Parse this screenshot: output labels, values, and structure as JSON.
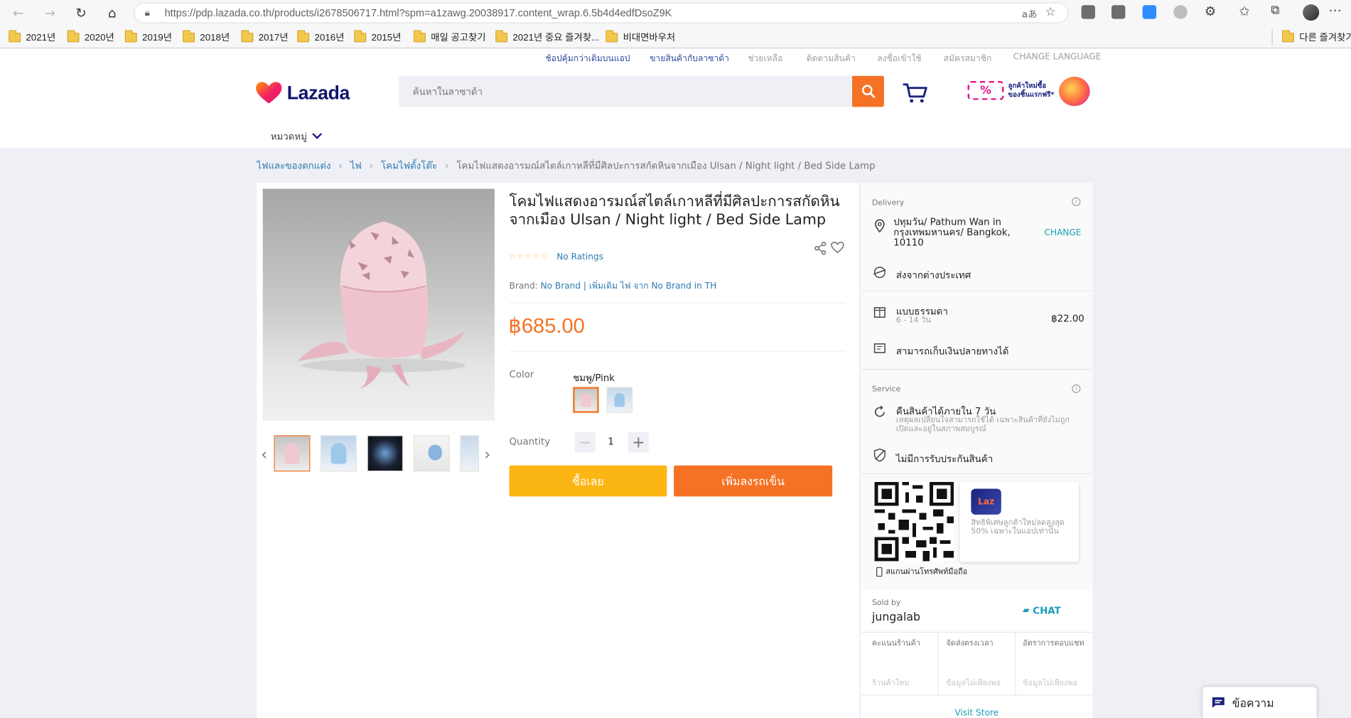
{
  "browser": {
    "url": "https://pdp.lazada.co.th/products/i2678506717.html?spm=a1zawg.20038917.content_wrap.6.5b4d4edfDsoZ9K",
    "reader_label": "aあ",
    "bookmarks": [
      "2021년",
      "2020년",
      "2019년",
      "2018년",
      "2017년",
      "2016년",
      "2015년",
      "매일 공고찾기",
      "2021년 중요 즐겨찾...",
      "비대면바우처"
    ],
    "other_bookmarks": "다른 즐겨찾기"
  },
  "toplinks": [
    "ช้อปคุ้มกว่าเดิมบนแอป",
    "ขายสินค้ากับลาซาด้า",
    "ช่วยเหลือ",
    "ติดตามสินค้า",
    "ลงชื่อเข้าใช้",
    "สมัครสมาชิก",
    "CHANGE LANGUAGE"
  ],
  "header": {
    "logo_text": "Lazada",
    "search_placeholder": "ค้นหาในลาซาด้า",
    "category_label": "หมวดหมู่",
    "promo_line1": "ลูกค้าใหม่ซื้อ",
    "promo_line2": "ของชิ้นแรกฟรี*"
  },
  "breadcrumb": {
    "items": [
      "ไฟและของตกแต่ง",
      "ไฟ",
      "โคมไฟตั้งโต๊ะ"
    ],
    "current": "โคมไฟแสดงอารมณ์สไตล์เกาหลีที่มีศิลปะการสกัดหินจากเมือง Ulsan / Night light / Bed Side Lamp"
  },
  "product": {
    "title": "โคมไฟแสดงอารมณ์สไตล์เกาหลีที่มีศิลปะการสกัดหินจากเมือง Ulsan / Night light / Bed Side Lamp",
    "rating_text": "No Ratings",
    "brand_label": "Brand:",
    "brand_name": "No Brand",
    "brand_more": "| เพิ่มเติม ไฟ จาก No Brand in TH",
    "price": "฿685.00",
    "color_label": "Color",
    "color_value": "ชมพู/Pink",
    "quantity_label": "Quantity",
    "quantity": "1",
    "buy_label": "ซื้อเลย",
    "cart_label": "เพิ่มลงรถเข็น"
  },
  "delivery": {
    "title": "Delivery",
    "address": "ปทุมวัน/ Pathum Wan in กรุงเทพมหานคร/ Bangkok, 10110",
    "change_label": "CHANGE",
    "overseas": "ส่งจากต่างประเทศ",
    "standard": "แบบธรรมดา",
    "standard_days": "6 - 14 วัน",
    "standard_price": "฿22.00",
    "cod": "สามารถเก็บเงินปลายทางได้"
  },
  "service": {
    "title": "Service",
    "return_title": "คืนสินค้าได้ภายใน 7 วัน",
    "return_note": "เหตุผลเปลี่ยนใจสามารถใช้ได้ เฉพาะสินค้าที่ยังไม่ถูกเปิดและอยู่ในสภาพสมบูรณ์",
    "warranty": "ไม่มีการรับประกันสินค้า"
  },
  "app": {
    "icon_text": "Laz",
    "promo": "สิทธิพิเศษลูกค้าใหม่ลดสูงสุด 50% เฉพาะในแอปเท่านั้น",
    "scan": "สแกนผ่านโทรศัพท์มือถือ"
  },
  "seller": {
    "sold_by_label": "Sold by",
    "name": "jungalab",
    "chat_label": "CHAT",
    "stats_headers": [
      "คะแนนร้านค้า",
      "จัดส่งตรงเวลา",
      "อัตราการตอบแชท"
    ],
    "stats_values": [
      "ร้านค้าใหม่",
      "ข้อมูลไม่เพียงพอ",
      "ข้อมูลไม่เพียงพอ"
    ],
    "visit_store": "Visit Store"
  },
  "message_label": "ข้อความ",
  "colors": {
    "accent": "#f57224",
    "buy": "#fcb614",
    "link": "#2e7bb0"
  }
}
